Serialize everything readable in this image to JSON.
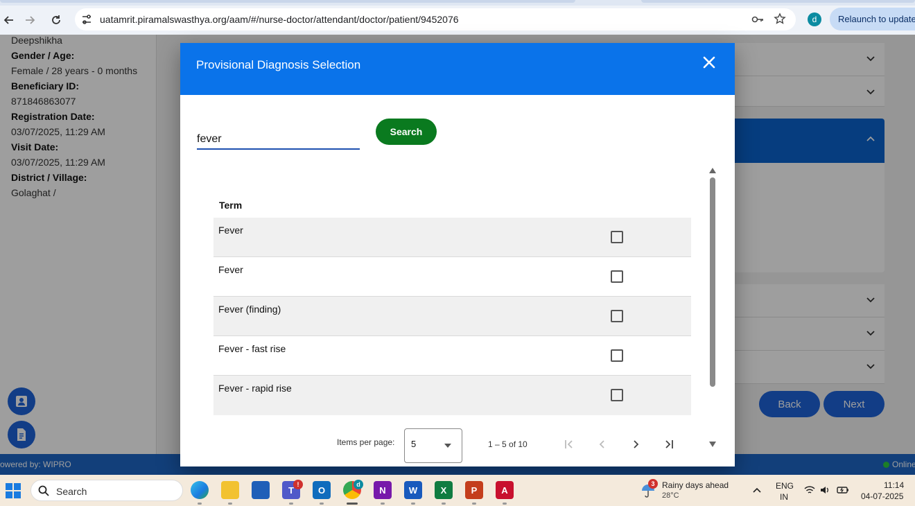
{
  "browser": {
    "url": "uatamrit.piramalswasthya.org/aam/#/nurse-doctor/attendant/doctor/patient/9452076",
    "profile_initial": "d",
    "relaunch_label": "Relaunch to update"
  },
  "patient": {
    "name": "Deepshikha",
    "gender_age_label": "Gender / Age:",
    "gender_age_value": "Female / 28 years - 0 months",
    "beneficiary_label": "Beneficiary ID:",
    "beneficiary_value": "871846863077",
    "registration_label": "Registration Date:",
    "registration_value": "03/07/2025, 11:29 AM",
    "visit_label": "Visit Date:",
    "visit_value": "03/07/2025, 11:29 AM",
    "district_label": "District / Village:",
    "district_value": "Golaghat /"
  },
  "background": {
    "back_label": "Back",
    "next_label": "Next",
    "footer_powered": "owered by: WIPRO",
    "footer_status": "Online"
  },
  "dialog": {
    "title": "Provisional Diagnosis Selection",
    "search_value": "fever",
    "search_button": "Search",
    "table": {
      "header_term": "Term",
      "rows": [
        {
          "term": "Fever",
          "checked": false
        },
        {
          "term": "Fever",
          "checked": false
        },
        {
          "term": "Fever (finding)",
          "checked": false
        },
        {
          "term": "Fever - fast rise",
          "checked": false
        },
        {
          "term": "Fever - rapid rise",
          "checked": false
        }
      ]
    },
    "paginator": {
      "items_per_page_label": "Items per page:",
      "items_per_page_value": "5",
      "range_label": "1 – 5 of 10"
    }
  },
  "taskbar": {
    "search_label": "Search",
    "outlook_badge": "!",
    "chrome_badge": "d",
    "weather_badge": "3",
    "weather_title": "Rainy days ahead",
    "weather_temp": "28°C",
    "lang_top": "ENG",
    "lang_bottom": "IN",
    "time": "11:14",
    "date": "04-07-2025"
  },
  "colors": {
    "dialog_header": "#0a73ea",
    "search_button": "#0a7a1f",
    "primary_blue": "#1d63d8",
    "footer": "#1e66c6"
  }
}
